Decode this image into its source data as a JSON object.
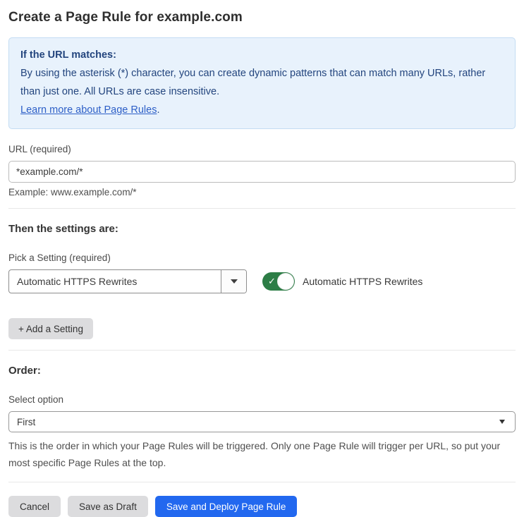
{
  "page": {
    "title": "Create a Page Rule for example.com"
  },
  "info_box": {
    "heading": "If the URL matches:",
    "body": "By using the asterisk (*) character, you can create dynamic patterns that can match many URLs, rather than just one. All URLs are case insensitive.",
    "link_label": "Learn more about Page Rules",
    "link_suffix": "."
  },
  "url_field": {
    "label": "URL (required)",
    "value": "*example.com/*",
    "helper": "Example: www.example.com/*"
  },
  "settings_section": {
    "heading": "Then the settings are:",
    "picker_label": "Pick a Setting (required)",
    "picker_value": "Automatic HTTPS Rewrites",
    "toggle_label": "Automatic HTTPS Rewrites",
    "toggle_state": "on",
    "toggle_check_glyph": "✓",
    "add_setting_label": "+ Add a Setting"
  },
  "order_section": {
    "heading": "Order:",
    "select_label": "Select option",
    "select_value": "First",
    "helper": "This is the order in which your Page Rules will be triggered. Only one Page Rule will trigger per URL, so put your most specific Page Rules at the top."
  },
  "footer": {
    "cancel_label": "Cancel",
    "save_draft_label": "Save as Draft",
    "save_deploy_label": "Save and Deploy Page Rule"
  },
  "colors": {
    "accent_blue": "#2268ef",
    "info_background": "#e8f2fc",
    "info_border": "#c3dcf3",
    "info_text": "#23457e",
    "link_blue": "#2d5fc7",
    "toggle_green": "#2d7d46",
    "button_gray": "#dcdcde"
  }
}
